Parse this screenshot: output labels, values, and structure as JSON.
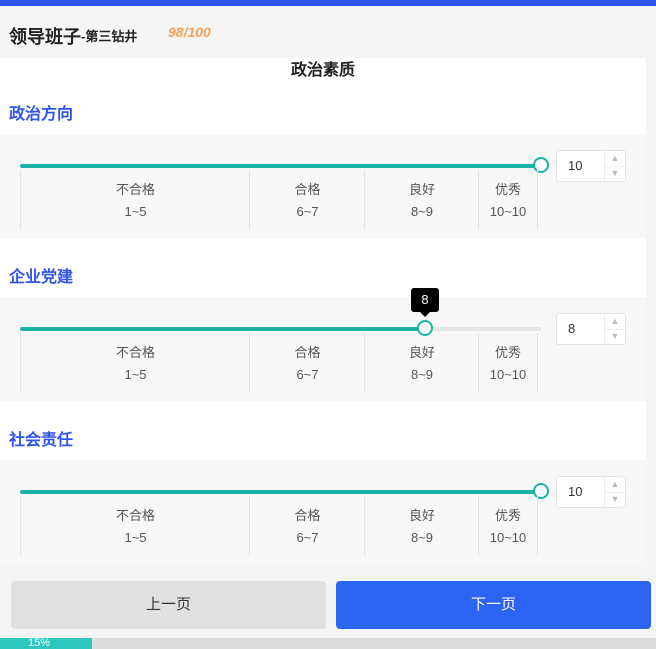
{
  "colors": {
    "accent": "#2f54eb",
    "slider": "#1bb3a3",
    "score": "#f5a05a",
    "next_button": "#2a64f0",
    "progress": "#2ec7c0"
  },
  "header": {
    "title": "领导班子",
    "subtitle": "-第三钻井",
    "score": "98/100"
  },
  "section": {
    "title": "政治素质"
  },
  "categories": [
    {
      "label": "政治方向",
      "value": "10",
      "value_fraction": 1.0,
      "show_tooltip": false,
      "tooltip": "",
      "grades": [
        {
          "name": "不合格",
          "range": "1~5"
        },
        {
          "name": "合格",
          "range": "6~7"
        },
        {
          "name": "良好",
          "range": "8~9"
        },
        {
          "name": "优秀",
          "range": "10~10"
        }
      ]
    },
    {
      "label": "企业党建",
      "value": "8",
      "value_fraction": 0.778,
      "show_tooltip": true,
      "tooltip": "8",
      "grades": [
        {
          "name": "不合格",
          "range": "1~5"
        },
        {
          "name": "合格",
          "range": "6~7"
        },
        {
          "name": "良好",
          "range": "8~9"
        },
        {
          "name": "优秀",
          "range": "10~10"
        }
      ]
    },
    {
      "label": "社会责任",
      "value": "10",
      "value_fraction": 1.0,
      "show_tooltip": false,
      "tooltip": "",
      "grades": [
        {
          "name": "不合格",
          "range": "1~5"
        },
        {
          "name": "合格",
          "range": "6~7"
        },
        {
          "name": "良好",
          "range": "8~9"
        },
        {
          "name": "优秀",
          "range": "10~10"
        }
      ]
    }
  ],
  "stepper": {
    "up_icon": "chevron-up-icon",
    "down_icon": "chevron-down-icon"
  },
  "footer": {
    "prev_label": "上一页",
    "next_label": "下一页"
  },
  "progress": {
    "label": "15%",
    "value_fraction": 0.14
  }
}
